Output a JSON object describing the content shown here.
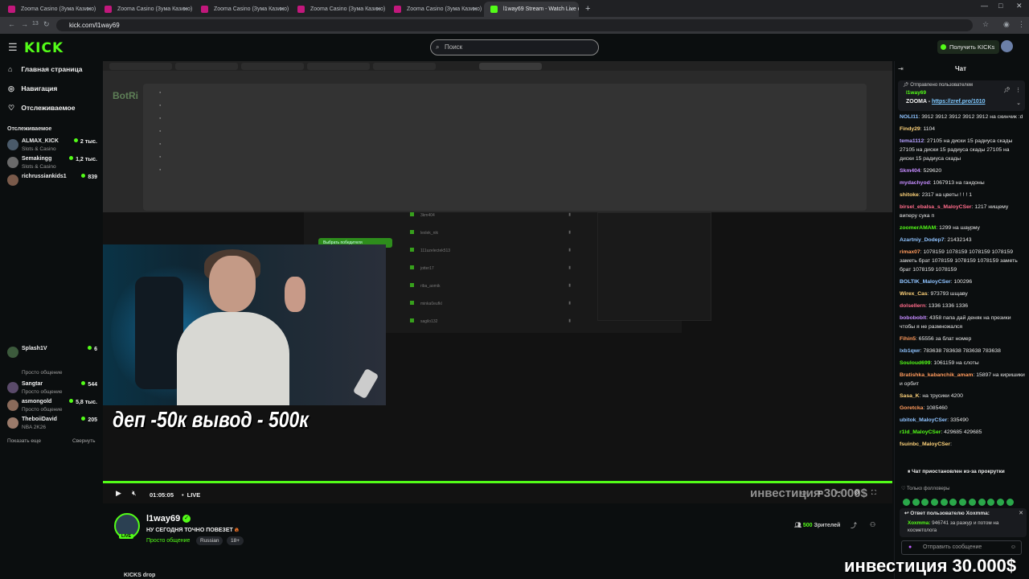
{
  "browser": {
    "tabs": [
      {
        "title": "Zooma Casino (Зума Казино) o"
      },
      {
        "title": "Zooma Casino (Зума Казино) o"
      },
      {
        "title": "Zooma Casino (Зума Казино) o"
      },
      {
        "title": "Zooma Casino (Зума Казино) o"
      },
      {
        "title": "Zooma Casino (Зума Казино) o"
      },
      {
        "title": "l1way69 Stream - Watch Live o"
      }
    ],
    "tab_count": "13",
    "url": "kick.com/l1way69"
  },
  "header": {
    "logo": "KICK",
    "search_placeholder": "Поиск",
    "get_kicks": "Получить KICKs"
  },
  "sidebar": {
    "nav": [
      {
        "label": "Главная страница",
        "icon": "home-icon"
      },
      {
        "label": "Навигация",
        "icon": "compass-icon"
      },
      {
        "label": "Отслеживаемое",
        "icon": "heart-icon"
      }
    ],
    "followed_title": "Отслеживаемое",
    "channels": [
      {
        "name": "ALMAX_KICK",
        "category": "Slots & Casino",
        "viewers": "2 тыс."
      },
      {
        "name": "Semakingg",
        "category": "Slots & Casino",
        "viewers": "1,2 тыс."
      },
      {
        "name": "richrussiankids1",
        "category": "",
        "viewers": "839"
      },
      {
        "name": "Splash1V",
        "category": "",
        "viewers": "6"
      },
      {
        "name": "",
        "category": "Просто общение",
        "viewers": ""
      },
      {
        "name": "Sangtar",
        "category": "Просто общение",
        "viewers": "544"
      },
      {
        "name": "asmongold",
        "category": "Просто общение",
        "viewers": "5,8 тыс."
      },
      {
        "name": "TheboiiDavid",
        "category": "NBA 2K26",
        "viewers": "205"
      }
    ],
    "show_more": "Показать еще",
    "collapse": "Свернуть"
  },
  "video": {
    "overlay_text": "деп -50к вывод - 500к",
    "time": "01:05:05",
    "live": "LIVE",
    "ticker": "инвестиция 30.000$",
    "inner_logo": "BotRi",
    "inner_rows": [
      "3km404",
      "lexlek_nik",
      "111uzelectek513",
      "jotter17",
      "riba_aomik",
      "minka0eufkl",
      "sagilo132"
    ],
    "inner_button": "Выбрать победителя"
  },
  "stream": {
    "name": "l1way69",
    "title": "НУ СЕГОДНЯ ТОЧНО ПОВЕЗЕТ",
    "category": "Просто общение",
    "tags": [
      "Russian",
      "18+"
    ],
    "viewers": "500",
    "viewers_label": "Зрителей",
    "live_badge": "LIVE",
    "kicks_drop": "KICKS drop"
  },
  "chat": {
    "title": "Чат",
    "pinned": {
      "label": "Отправлено пользователем",
      "user": "l1way69",
      "text": "ZOOMA - ",
      "link": "https://zref.pro/1010"
    },
    "messages": [
      {
        "user": "NOLI11",
        "color": "#8fc3ff",
        "text": "3912 3912 3912 3912 3912 на скинчик :d"
      },
      {
        "user": "Findy29",
        "color": "#ffd37a",
        "text": "1104"
      },
      {
        "user": "tema1112",
        "color": "#b5a0ff",
        "text": "27105 на диски 15 радиуса скады 27105 на диски 15 радиуса скады 27105 на диски 15 радиуса скады"
      },
      {
        "user": "Skm404",
        "color": "#c58cff",
        "text": "529620"
      },
      {
        "user": "mydachyod",
        "color": "#c58cff",
        "text": "1067913 на гандоны"
      },
      {
        "user": "shitoke",
        "color": "#ffd37a",
        "text": "2317 на цветы ! ! ! 1"
      },
      {
        "user": "birsel_ebalsa_s_MaloyCSer",
        "color": "#ff6b8a",
        "text": "1217 нищему виперу сука п"
      },
      {
        "user": "zoomerAMAM",
        "color": "#53fc18",
        "text": "1299 на шаурму"
      },
      {
        "user": "Azartniy_Dodep7",
        "color": "#8fc3ff",
        "text": "21432143"
      },
      {
        "user": "rimax07",
        "color": "#ff9a5c",
        "text": "1078159 1078159 1078159 1078159 заметь брат 1078159 1078159 1078159 заметь брат 1078159 1078159"
      },
      {
        "user": "BOLTIK_MaloyCSer",
        "color": "#8fc3ff",
        "text": "100296"
      },
      {
        "user": "Wirex_Cas",
        "color": "#ffd37a",
        "text": "973793 шщаву"
      },
      {
        "user": "dolsellern",
        "color": "#ff6b8a",
        "text": "1336 1336 1336"
      },
      {
        "user": "boboboblt",
        "color": "#c58cff",
        "text": "4358 папа дай деняк на презики чтобы я не размножался"
      },
      {
        "user": "Fihin5",
        "color": "#ff9a5c",
        "text": "65556 за блат номер"
      },
      {
        "user": "lxb1qwr",
        "color": "#8fc3ff",
        "text": "783638 783638 783638 783638"
      },
      {
        "user": "Souloud699",
        "color": "#53fc18",
        "text": "1061159 на слоты"
      },
      {
        "user": "Bratishka_kabanchik_amam",
        "color": "#ff9a5c",
        "text": "15897 на киришики и орбит"
      },
      {
        "user": "Sasa_K",
        "color": "#ffd37a",
        "text": "на трусики 4200"
      },
      {
        "user": "Goretcka",
        "color": "#ff9a5c",
        "text": "1085460"
      },
      {
        "user": "ubitok_MaloyCSer",
        "color": "#8fc3ff",
        "text": "335490"
      },
      {
        "user": "r1ld_MaloyCSer",
        "color": "#53fc18",
        "text": "429685 429685"
      },
      {
        "user": "fsuinbc_MaloyCSer",
        "color": "#ffd37a",
        "text": ""
      }
    ],
    "paused": "Чат приостановлен из-за прокрутки",
    "followers_only": "Только фолловеры",
    "reply_title": "Ответ пользователю Xoxmma:",
    "reply_user": "Xoxmma:",
    "reply_text": " 946741 за разкур и потом на косметолога",
    "input_placeholder": "Отправить сообщение",
    "ticker": "инвестиция 30.000$"
  }
}
